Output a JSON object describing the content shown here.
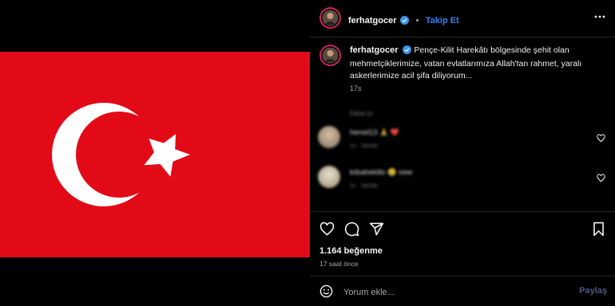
{
  "post": {
    "username": "ferhatgocer",
    "follow_label": "Takip Et",
    "separator": "•",
    "caption_text": "Pençe-Kilit Harekâtı bölgesinde şehit olan mehmetçiklerimize, vatan evlatlarımıza Allah'tan rahmet, yaralı askerlerimize acil şifa diliyorum...",
    "caption_time": "17s",
    "likes": "1.164 beğenme",
    "posted_ago": "17 saat önce"
  },
  "comments": [
    {
      "user": "hemel13",
      "reaction": "🙏 ❤️",
      "reply_label": "Yanıtla",
      "time": "1s"
    },
    {
      "user": "kdsahekillo",
      "reaction": "😢 vww",
      "reply_label": "Yanıtla",
      "time": "1s"
    }
  ],
  "comments_hint": "Daha iyi",
  "compose": {
    "placeholder": "Yorum ekle...",
    "share_label": "Paylaş"
  },
  "icons": {
    "more": "more-dots-icon",
    "like": "heart-icon",
    "comment": "comment-icon",
    "share": "paper-plane-icon",
    "save": "bookmark-icon",
    "emoji": "smiley-icon",
    "verified": "verified-badge-icon"
  },
  "colors": {
    "flag_red": "#e30a17",
    "follow_blue": "#3c7ff5",
    "verified_blue": "#3897f0"
  }
}
